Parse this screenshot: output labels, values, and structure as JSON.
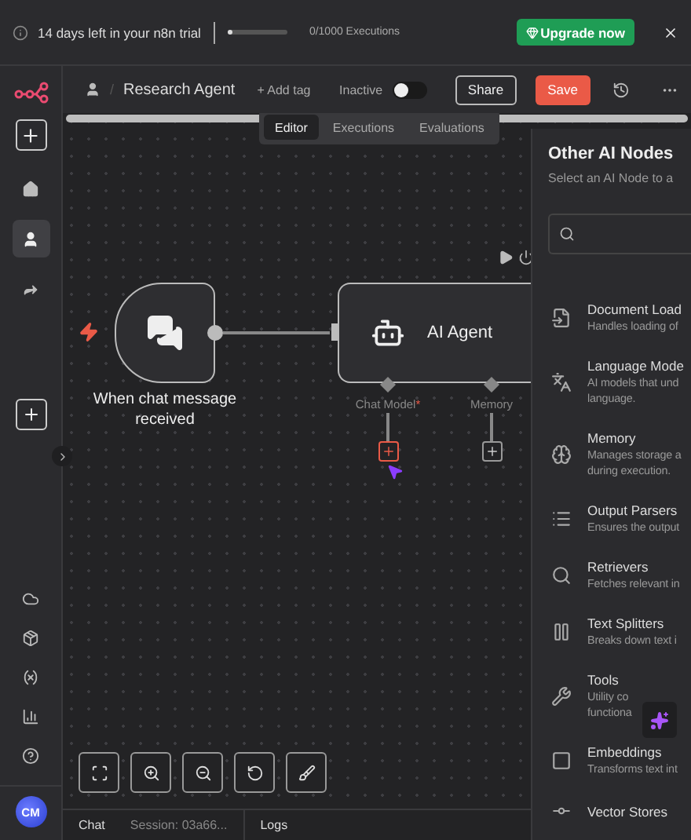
{
  "trial_banner": {
    "message": "14 days left in your n8n trial",
    "executions": {
      "level": 0.01,
      "reading": "0/1000 Executions"
    },
    "upgrade_button": "Upgrade now"
  },
  "header": {
    "breadcrumb_separator": "/",
    "workflow_name": "Research Agent",
    "add_tag": "+ Add tag",
    "active_label": "Inactive",
    "active": false,
    "share_button": "Share",
    "save_button": "Save"
  },
  "view_tabs": [
    {
      "label": "Editor",
      "selected": true
    },
    {
      "label": "Executions",
      "selected": false
    },
    {
      "label": "Evaluations",
      "selected": false
    }
  ],
  "sidebar": {
    "items": [
      {
        "kind": "home",
        "selected": false
      },
      {
        "kind": "personal",
        "selected": true
      },
      {
        "kind": "shared",
        "selected": false
      }
    ],
    "avatar": "CM"
  },
  "canvas": {
    "trigger_node": {
      "label": "When chat message received"
    },
    "agent_node": {
      "label": "AI Agent",
      "required_mark": "*",
      "inputs": [
        {
          "label": "Chat Model",
          "required": true,
          "error": true
        },
        {
          "label": "Memory",
          "required": false,
          "error": false
        }
      ]
    }
  },
  "bottom_bar": {
    "chat_tab": "Chat",
    "session": "Session: 03a66...",
    "logs_tab": "Logs"
  },
  "panel": {
    "title": "Other AI Nodes",
    "subtitle": "Select an AI Node to a",
    "items": [
      {
        "kind": "document",
        "title": "Document Load",
        "lines": [
          "Handles loading of"
        ]
      },
      {
        "kind": "language",
        "title": "Language Mode",
        "lines": [
          "AI models that und",
          "language."
        ]
      },
      {
        "kind": "memory",
        "title": "Memory",
        "lines": [
          "Manages storage a",
          "during execution."
        ]
      },
      {
        "kind": "parser",
        "title": "Output Parsers",
        "lines": [
          "Ensures the output"
        ]
      },
      {
        "kind": "retriever",
        "title": "Retrievers",
        "lines": [
          "Fetches relevant in"
        ]
      },
      {
        "kind": "splitter",
        "title": "Text Splitters",
        "lines": [
          "Breaks down text i"
        ]
      },
      {
        "kind": "tools",
        "title": "Tools",
        "lines": [
          "Utility co",
          "functiona"
        ]
      },
      {
        "kind": "embeddings",
        "title": "Embeddings",
        "lines": [
          "Transforms text int"
        ]
      },
      {
        "kind": "vector",
        "title": "Vector Stores"
      }
    ]
  }
}
